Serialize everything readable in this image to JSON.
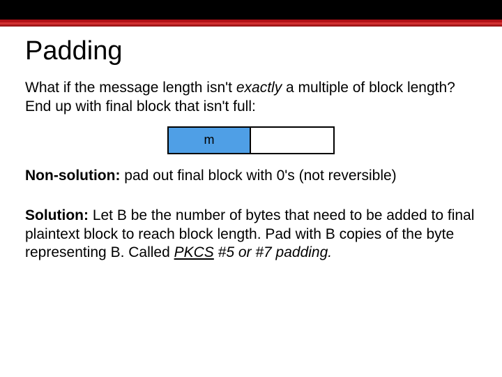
{
  "title": "Padding",
  "intro": {
    "part1": "What if the message length isn't ",
    "exactly": "exactly",
    "part2": " a multiple of block length?  End up with final block that isn't full:"
  },
  "block": {
    "label": "m"
  },
  "nonsolution": {
    "label": "Non-solution:",
    "text": "  pad out final block with 0's (not reversible)"
  },
  "solution": {
    "label": "Solution:",
    "text": "  Let B be the number of bytes that need to be added to final plaintext block to reach block length.  Pad with B copies of the byte representing B. Called ",
    "pkcs": "PKCS",
    "suffix": " #5 or #7 padding."
  }
}
